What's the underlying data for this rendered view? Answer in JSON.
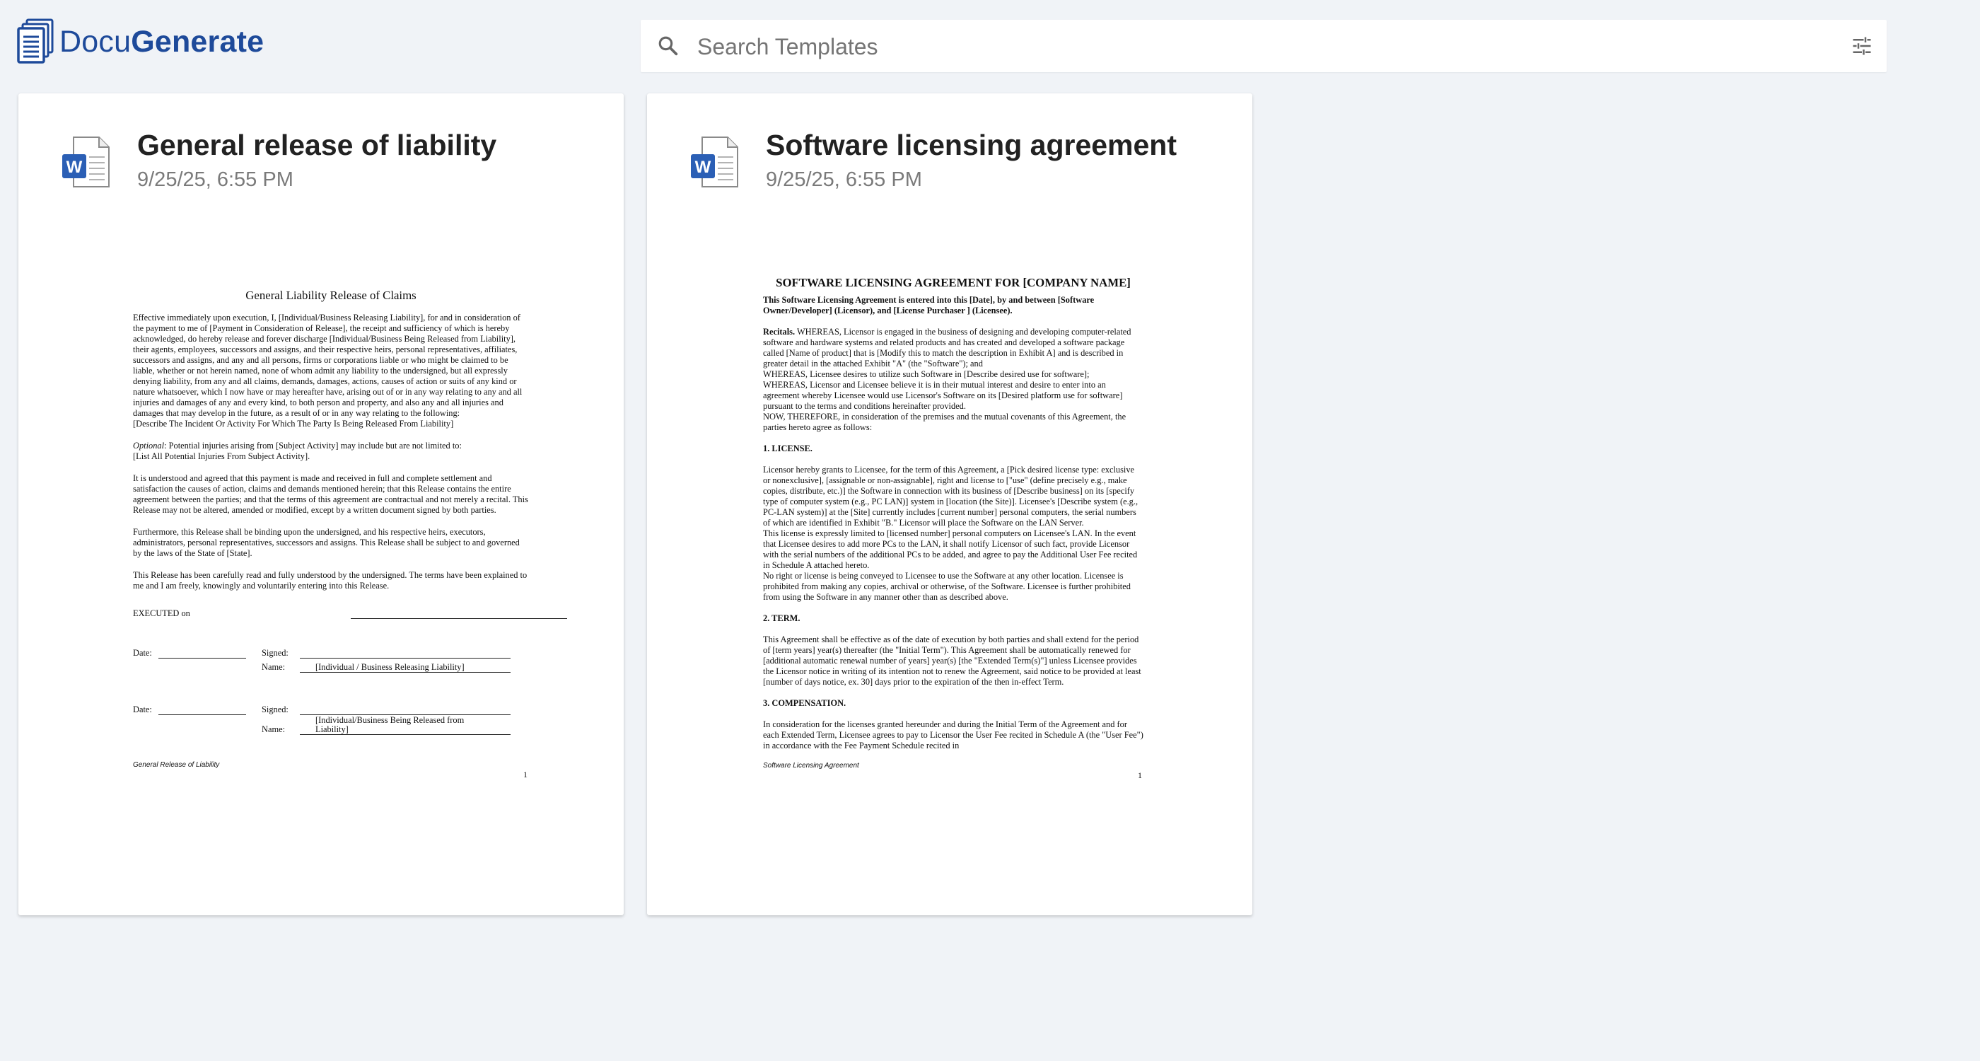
{
  "app": {
    "brand_prefix": "Docu",
    "brand_suffix": "Generate"
  },
  "search": {
    "placeholder": "Search Templates",
    "value": ""
  },
  "colors": {
    "brand": "#1e4a9a",
    "word_blue": "#2b5fb5",
    "background": "#f0f3f7"
  },
  "templates": [
    {
      "title": "General release of liability",
      "date": "9/25/25, 6:55 PM",
      "icon": "word-file-icon",
      "preview": {
        "title": "General Liability Release of Claims",
        "paragraphs": [
          "Effective immediately upon execution, I, [Individual/Business Releasing Liability], for and in consideration of the payment to me of [Payment in Consideration of Release], the receipt and sufficiency of which is hereby acknowledged, do hereby release and forever discharge [Individual/Business Being Released from Liability], their agents, employees, successors and assigns, and their respective heirs, personal representatives, affiliates, successors and assigns, and any and all persons, firms or corporations liable or who might be claimed to be liable, whether or not herein named, none of whom admit any liability to the undersigned, but all expressly denying liability, from any and all claims, demands, damages, actions, causes of action or suits of any kind or nature whatsoever, which I now have or may hereafter have, arising out of or in any way relating to any and all injuries and damages of any and every kind, to both person and property, and also any and all injuries and damages that may develop in the future, as a result of or in any way relating to the following:\n[Describe The Incident Or Activity For Which The Party Is Being Released From Liability]",
          "Potential injuries arising from [Subject Activity] may include but are not limited to:\n[List All Potential Injuries From Subject Activity].",
          "It is understood and agreed that this payment is made and received in full and complete settlement and satisfaction the causes of action, claims and demands mentioned herein; that this Release contains the entire agreement between the parties; and that the terms of this agreement are contractual and not merely a recital. This Release may not be altered, amended or modified, except by a written document signed by both parties.",
          "Furthermore, this Release shall be binding upon the undersigned, and his respective heirs, executors, administrators, personal representatives, successors and assigns. This Release shall be subject to and governed by the laws of the State of [State].",
          "This Release has been carefully read and fully understood by the undersigned. The terms have been explained to me and I am freely, knowingly and voluntarily entering into this Release."
        ],
        "optional_label": "Optional",
        "executed_label": "EXECUTED on",
        "date_label": "Date:",
        "signed_label": "Signed:",
        "name_label": "Name:",
        "party1_name": "[Individual / Business Releasing Liability]",
        "party2_name": "[Individual/Business Being Released from Liability]",
        "footer": "General Release of Liability",
        "page": "1"
      }
    },
    {
      "title": "Software licensing agreement",
      "date": "9/25/25, 6:55 PM",
      "icon": "word-file-icon",
      "preview": {
        "title": "SOFTWARE LICENSING AGREEMENT FOR [COMPANY NAME]",
        "intro": "This Software Licensing Agreement is entered into this [Date], by and between [Software Owner/Developer] (Licensor), and [License Purchaser ] (Licensee).",
        "recitals_label": "Recitals.",
        "recitals": "WHEREAS, Licensor is engaged in the business of designing and developing computer-related software and hardware systems and related products and has created and developed a software package called [Name of product] that is [Modify this to match the description in Exhibit A] and is described in greater detail in the attached Exhibit \"A\" (the \"Software\"); and\nWHEREAS, Licensee desires to utilize such Software in [Describe desired use for software];\nWHEREAS, Licensor and Licensee believe it is in their mutual interest and desire to enter into an agreement whereby Licensee would use Licensor's Software on its [Desired platform use for software] pursuant to the terms and conditions hereinafter provided.\nNOW, THEREFORE, in consideration of the premises and the mutual covenants of this Agreement, the parties hereto agree as follows:",
        "license_heading": "1. LICENSE.",
        "license": "Licensor hereby grants to Licensee, for the term of this Agreement, a [Pick desired license type: exclusive or nonexclusive], [assignable or non-assignable], right and license to [\"use\" (define precisely e.g., make copies, distribute, etc.)] the Software in connection with its business of [Describe business] on its [specify type of computer system (e.g., PC LAN)] system in [location (the Site)]. Licensee's [Describe system (e.g., PC-LAN system)] at the [Site] currently includes [current number] personal computers, the serial numbers of which are identified in Exhibit \"B.\" Licensor will place the Software on the LAN Server.\nThis license is expressly limited to [licensed number] personal computers on Licensee's LAN. In the event that Licensee desires to add more PCs to the LAN, it shall notify Licensor of such fact, provide Licensor with the serial numbers of the additional PCs to be added, and agree to pay the Additional User Fee recited in Schedule A attached hereto.\nNo right or license is being conveyed to Licensee to use the Software at any other location. Licensee is prohibited from making any copies, archival or otherwise, of the Software. Licensee is further prohibited from using the Software in any manner other than as described above.",
        "term_heading": "2. TERM.",
        "term": "This Agreement shall be effective as of the date of execution by both parties and shall extend for the period of [term years] year(s) thereafter (the \"Initial Term\"). This Agreement shall be automatically renewed for [additional automatic renewal number of years] year(s) [the \"Extended Term(s)\"] unless Licensee provides the Licensor notice in writing of its intention not to renew the Agreement, said notice to be provided at least [number of days notice, ex. 30] days prior to the expiration of the then in-effect Term.",
        "comp_heading": "3. COMPENSATION.",
        "comp": "In consideration for the licenses granted hereunder and during the Initial Term of the Agreement and for each Extended Term, Licensee agrees to pay to Licensor the User Fee recited in Schedule A (the \"User Fee\") in accordance with the Fee Payment Schedule recited in",
        "footer": "Software Licensing Agreement",
        "page": "1"
      }
    }
  ]
}
